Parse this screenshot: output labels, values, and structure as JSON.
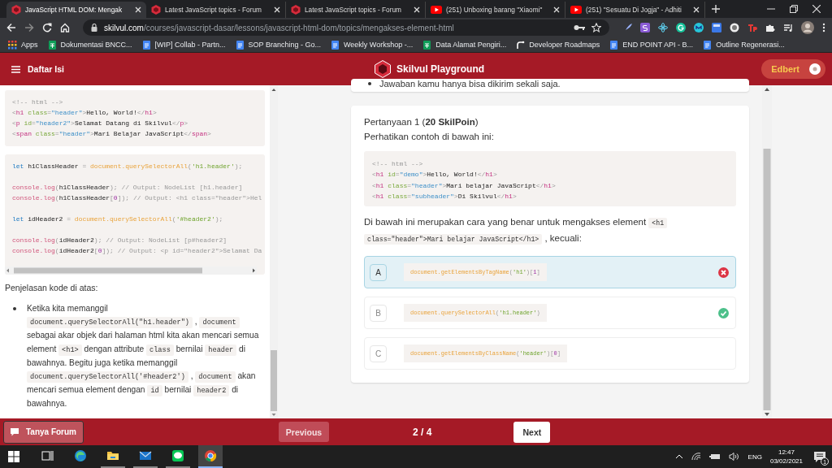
{
  "browser": {
    "tabs": [
      {
        "title": "JavaScript HTML DOM: Mengak",
        "kind": "hexagon",
        "selected": true
      },
      {
        "title": "Latest JavaScript topics - Forum",
        "kind": "hexagon",
        "selected": false
      },
      {
        "title": "Latest JavaScript topics - Forum",
        "kind": "hexagon",
        "selected": false
      },
      {
        "title": "(251) Unboxing barang \"Xiaomi\"",
        "kind": "play",
        "selected": false
      },
      {
        "title": "(251) \"Sesuatu Di Jogja\" - Adhiti",
        "kind": "play",
        "selected": false
      }
    ],
    "address": {
      "host": "skilvul.com",
      "path": "/courses/javascript-dasar/lessons/javascript-html-dom/topics/mengakses-element-html"
    },
    "bookmarks": [
      {
        "label": "Apps",
        "kind": "grid"
      },
      {
        "label": "Dokumentasi BNCC...",
        "kind": "sheet"
      },
      {
        "label": "[WIP] Collab - Partn...",
        "kind": "doc"
      },
      {
        "label": "SOP Branching - Go...",
        "kind": "doc"
      },
      {
        "label": "Weekly Workshop -...",
        "kind": "doc"
      },
      {
        "label": "Data Alamat Pengiri...",
        "kind": "sheet"
      },
      {
        "label": "Developer Roadmaps",
        "kind": "roadmap"
      },
      {
        "label": "END POINT API - B...",
        "kind": "doc"
      },
      {
        "label": "Outline Regenerasi...",
        "kind": "doc"
      }
    ]
  },
  "header": {
    "menu_label": "Daftar Isi",
    "brand": "Skilvul Playground",
    "user": "Edbert"
  },
  "lesson": {
    "code_blocks": [
      {
        "groups": [
          [
            [
              {
                "kind": "cm",
                "t": "<!-- html -->"
              }
            ],
            [
              {
                "kind": "p",
                "t": "<"
              },
              {
                "kind": "tag",
                "t": "h1"
              },
              {
                "kind": "attr",
                "t": " class"
              },
              {
                "kind": "p",
                "t": "="
              },
              {
                "kind": "val",
                "t": "\"header\""
              },
              {
                "kind": "p",
                "t": ">"
              },
              {
                "kind": "x",
                "t": "Hello, World!"
              },
              {
                "kind": "p",
                "t": "</"
              },
              {
                "kind": "tag",
                "t": "h1"
              },
              {
                "kind": "p",
                "t": ">"
              }
            ],
            [
              {
                "kind": "p",
                "t": "<"
              },
              {
                "kind": "tag",
                "t": "p"
              },
              {
                "kind": "attr",
                "t": " id"
              },
              {
                "kind": "p",
                "t": "="
              },
              {
                "kind": "val",
                "t": "\"header2\""
              },
              {
                "kind": "p",
                "t": ">"
              },
              {
                "kind": "x",
                "t": "Selamat Datang di Skilvul"
              },
              {
                "kind": "p",
                "t": "</"
              },
              {
                "kind": "tag",
                "t": "p"
              },
              {
                "kind": "p",
                "t": ">"
              }
            ],
            [
              {
                "kind": "p",
                "t": "<"
              },
              {
                "kind": "tag",
                "t": "span"
              },
              {
                "kind": "attr",
                "t": " class"
              },
              {
                "kind": "p",
                "t": "="
              },
              {
                "kind": "val",
                "t": "\"header\""
              },
              {
                "kind": "p",
                "t": ">"
              },
              {
                "kind": "x",
                "t": "Mari Belajar JavaScript"
              },
              {
                "kind": "p",
                "t": "</"
              },
              {
                "kind": "tag",
                "t": "span"
              },
              {
                "kind": "p",
                "t": ">"
              }
            ]
          ]
        ]
      },
      {
        "groups": [
          [
            [
              {
                "kind": "kw",
                "t": "let"
              },
              {
                "kind": "x",
                "t": " h1ClassHeader "
              },
              {
                "kind": "p",
                "t": "= "
              },
              {
                "kind": "fn",
                "t": "document.querySelectorAll"
              },
              {
                "kind": "p",
                "t": "("
              },
              {
                "kind": "str",
                "t": "'h1.header'"
              },
              {
                "kind": "p",
                "t": ");"
              }
            ]
          ],
          [
            [
              {
                "kind": "log",
                "t": "console.log"
              },
              {
                "kind": "p",
                "t": "("
              },
              {
                "kind": "x",
                "t": "h1ClassHeader"
              },
              {
                "kind": "p",
                "t": ");"
              },
              {
                "kind": "cm",
                "t": " // Output: NodeList [h1.header]"
              }
            ],
            [
              {
                "kind": "log",
                "t": "console.log"
              },
              {
                "kind": "p",
                "t": "("
              },
              {
                "kind": "x",
                "t": "h1ClassHeader"
              },
              {
                "kind": "p",
                "t": "["
              },
              {
                "kind": "num",
                "t": "0"
              },
              {
                "kind": "p",
                "t": "]);"
              },
              {
                "kind": "cm",
                "t": " // Output: <h1 class=\"header\">Hel"
              }
            ]
          ],
          [
            [
              {
                "kind": "kw",
                "t": "let"
              },
              {
                "kind": "x",
                "t": " idHeader2 "
              },
              {
                "kind": "p",
                "t": "= "
              },
              {
                "kind": "fn",
                "t": "document.querySelectorAll"
              },
              {
                "kind": "p",
                "t": "("
              },
              {
                "kind": "str",
                "t": "'#header2'"
              },
              {
                "kind": "p",
                "t": ");"
              }
            ]
          ],
          [
            [
              {
                "kind": "log",
                "t": "console.log"
              },
              {
                "kind": "p",
                "t": "("
              },
              {
                "kind": "x",
                "t": "idHeader2"
              },
              {
                "kind": "p",
                "t": ");"
              },
              {
                "kind": "cm",
                "t": " // Output: NodeList [p#header2]"
              }
            ],
            [
              {
                "kind": "log",
                "t": "console.log"
              },
              {
                "kind": "p",
                "t": "("
              },
              {
                "kind": "x",
                "t": "idHeader2"
              },
              {
                "kind": "p",
                "t": "["
              },
              {
                "kind": "num",
                "t": "0"
              },
              {
                "kind": "p",
                "t": "]);"
              },
              {
                "kind": "cm",
                "t": " // Output: <p id=\"header2\">Selamat Da"
              }
            ]
          ]
        ]
      }
    ],
    "explanation_title": "Penjelasan kode di atas:",
    "explanation_items": [
      [
        {
          "t": "Ketika kita memanggil "
        },
        {
          "t": "document.querySelectorAll(\"h1.header\")",
          "code": true
        },
        {
          "t": " , "
        },
        {
          "t": "document",
          "code": true
        },
        {
          "t": " sebagai akar objek dari halaman html kita akan mencari semua element "
        },
        {
          "t": "<h1>",
          "code": true
        },
        {
          "t": " dengan attribute "
        },
        {
          "t": "class",
          "code": true
        },
        {
          "t": " bernilai "
        },
        {
          "t": "header",
          "code": true
        },
        {
          "t": " di bawahnya. Begitu juga ketika memanggil "
        },
        {
          "t": "document.querySelectorAll('#header2')",
          "code": true
        },
        {
          "t": " , "
        },
        {
          "t": "document",
          "code": true
        },
        {
          "t": " akan mencari semua element dengan "
        },
        {
          "t": "id",
          "code": true
        },
        {
          "t": " bernilai "
        },
        {
          "t": "header2",
          "code": true
        },
        {
          "t": " di bawahnya."
        }
      ]
    ]
  },
  "quiz": {
    "note": "Jawaban kamu hanya bisa dikirim sekali saja.",
    "title": "Pertanyaan 1 (**20 SkilPoin**)",
    "intro": "Perhatikan contoh di bawah ini:",
    "code": [
      [
        [
          {
            "kind": "cm",
            "t": "<!-- html -->"
          }
        ],
        [
          {
            "kind": "p",
            "t": "<"
          },
          {
            "kind": "tag",
            "t": "h1"
          },
          {
            "kind": "attr",
            "t": " id"
          },
          {
            "kind": "p",
            "t": "="
          },
          {
            "kind": "val",
            "t": "\"demo\""
          },
          {
            "kind": "p",
            "t": ">"
          },
          {
            "kind": "x",
            "t": "Hello, World!"
          },
          {
            "kind": "p",
            "t": "</"
          },
          {
            "kind": "tag",
            "t": "h1"
          },
          {
            "kind": "p",
            "t": ">"
          }
        ],
        [
          {
            "kind": "p",
            "t": "<"
          },
          {
            "kind": "tag",
            "t": "h1"
          },
          {
            "kind": "attr",
            "t": " class"
          },
          {
            "kind": "p",
            "t": "="
          },
          {
            "kind": "val",
            "t": "\"header\""
          },
          {
            "kind": "p",
            "t": ">"
          },
          {
            "kind": "x",
            "t": "Mari belajar JavaScript"
          },
          {
            "kind": "p",
            "t": "</"
          },
          {
            "kind": "tag",
            "t": "h1"
          },
          {
            "kind": "p",
            "t": ">"
          }
        ],
        [
          {
            "kind": "p",
            "t": "<"
          },
          {
            "kind": "tag",
            "t": "h1"
          },
          {
            "kind": "attr",
            "t": " class"
          },
          {
            "kind": "p",
            "t": "="
          },
          {
            "kind": "val",
            "t": "\"subheader\""
          },
          {
            "kind": "p",
            "t": ">"
          },
          {
            "kind": "x",
            "t": "Di Skilvul"
          },
          {
            "kind": "p",
            "t": "</"
          },
          {
            "kind": "tag",
            "t": "h1"
          },
          {
            "kind": "p",
            "t": ">"
          }
        ]
      ]
    ],
    "prompt": [
      {
        "t": "Di bawah ini merupakan cara yang benar untuk mengakses element "
      },
      {
        "t": "<h1 class=\"header\">Mari belajar JavaScript</h1>",
        "code": true
      },
      {
        "t": " , kecuali:"
      }
    ],
    "options": [
      {
        "letter": "A",
        "selected": true,
        "kind": "wrong",
        "code": [
          {
            "kind": "fn",
            "t": "document.getElementsByTagName"
          },
          {
            "kind": "p",
            "t": "("
          },
          {
            "kind": "str",
            "t": "'h1'"
          },
          {
            "kind": "p",
            "t": ")["
          },
          {
            "kind": "num",
            "t": "1"
          },
          {
            "kind": "p",
            "t": "]"
          }
        ]
      },
      {
        "letter": "B",
        "selected": false,
        "kind": "correct",
        "code": [
          {
            "kind": "fn",
            "t": "document.querySelectorAll"
          },
          {
            "kind": "p",
            "t": "("
          },
          {
            "kind": "str",
            "t": "'h1.header'"
          },
          {
            "kind": "p",
            "t": ")"
          }
        ]
      },
      {
        "letter": "C",
        "selected": false,
        "kind": "plain",
        "code": [
          {
            "kind": "fn",
            "t": "document.getElementsByClassName"
          },
          {
            "kind": "p",
            "t": "("
          },
          {
            "kind": "str",
            "t": "'header'"
          },
          {
            "kind": "p",
            "t": ")["
          },
          {
            "kind": "num",
            "t": "0"
          },
          {
            "kind": "p",
            "t": "]"
          }
        ]
      }
    ]
  },
  "footer": {
    "forum": "Tanya Forum",
    "previous": "Previous",
    "progress": "2 / 4",
    "next": "Next"
  },
  "taskbar": {
    "apps": [
      {
        "kind": "taskview",
        "selected": false
      },
      {
        "kind": "edge",
        "selected": false
      },
      {
        "kind": "folder",
        "selected": false
      },
      {
        "kind": "mail",
        "selected": false
      },
      {
        "kind": "chat",
        "selected": false
      },
      {
        "kind": "chrome",
        "selected": true
      }
    ],
    "language": "ENG",
    "time": "12:47",
    "date": "03/02/2021",
    "notifications": "1"
  }
}
